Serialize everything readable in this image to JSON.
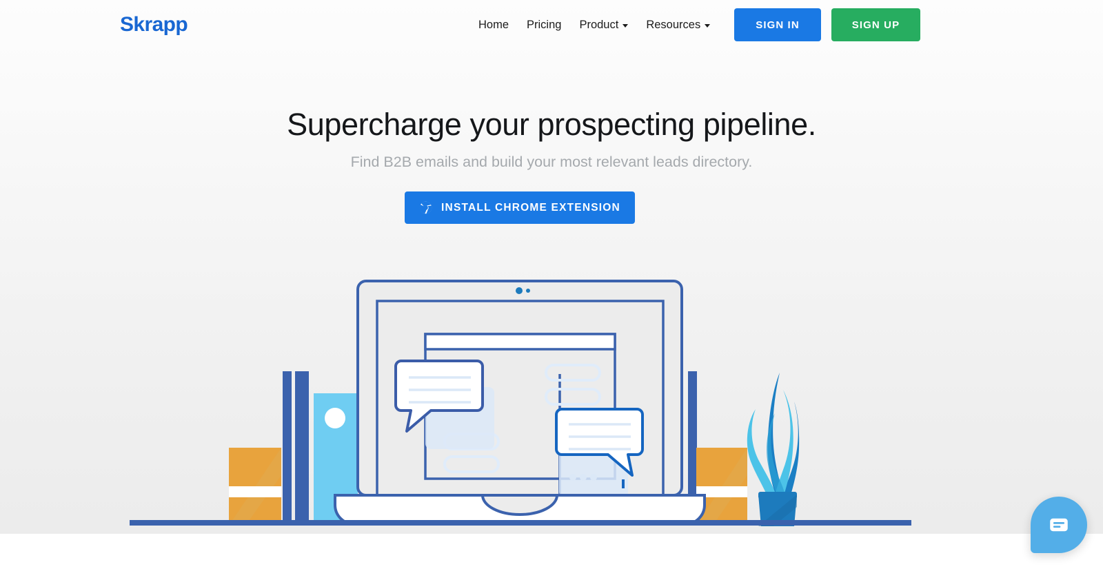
{
  "brand": {
    "logo_text": "Skrapp",
    "logo_color": "#1967d2"
  },
  "header": {
    "nav": [
      {
        "label": "Home",
        "has_caret": false
      },
      {
        "label": "Pricing",
        "has_caret": false
      },
      {
        "label": "Product",
        "has_caret": true
      },
      {
        "label": "Resources",
        "has_caret": true
      }
    ],
    "sign_in_label": "SIGN IN",
    "sign_in_color": "#1a79e4",
    "sign_up_label": "SIGN UP",
    "sign_up_color": "#27ad60"
  },
  "hero": {
    "headline": "Supercharge your prospecting pipeline.",
    "subheadline": "Find B2B emails and build your most relevant leads directory.",
    "cta_label": "INSTALL CHROME EXTENSION",
    "cta_icon": "chrome-icon",
    "cta_color": "#1a79e4",
    "background_top": "#fdfdfd",
    "background_bottom": "#ececec"
  },
  "illustration": {
    "name": "laptop-messaging-illustration",
    "colors": {
      "laptop_outline": "#3b62ad",
      "screen_fill": "#ececec",
      "bubble_border_left": "#3b5ca8",
      "bubble_border_right": "#1565c0",
      "bubble_fill": "#ffffff",
      "bubble_line": "#dbe8f7",
      "placeholder_fill": "#e8f0fb",
      "book_spine": "#3b62ad",
      "box_orange": "#e8a33d",
      "panel_light_blue": "#6fcdf2",
      "plant_leaf_dark": "#1b7fc4",
      "plant_leaf_light": "#4cc3e8",
      "plant_pot": "#1d7bbd",
      "ground_line": "#3b62ad"
    }
  },
  "chat": {
    "widget_label": "chat-widget",
    "icon": "message-bubble-icon",
    "color": "#53aee8"
  }
}
